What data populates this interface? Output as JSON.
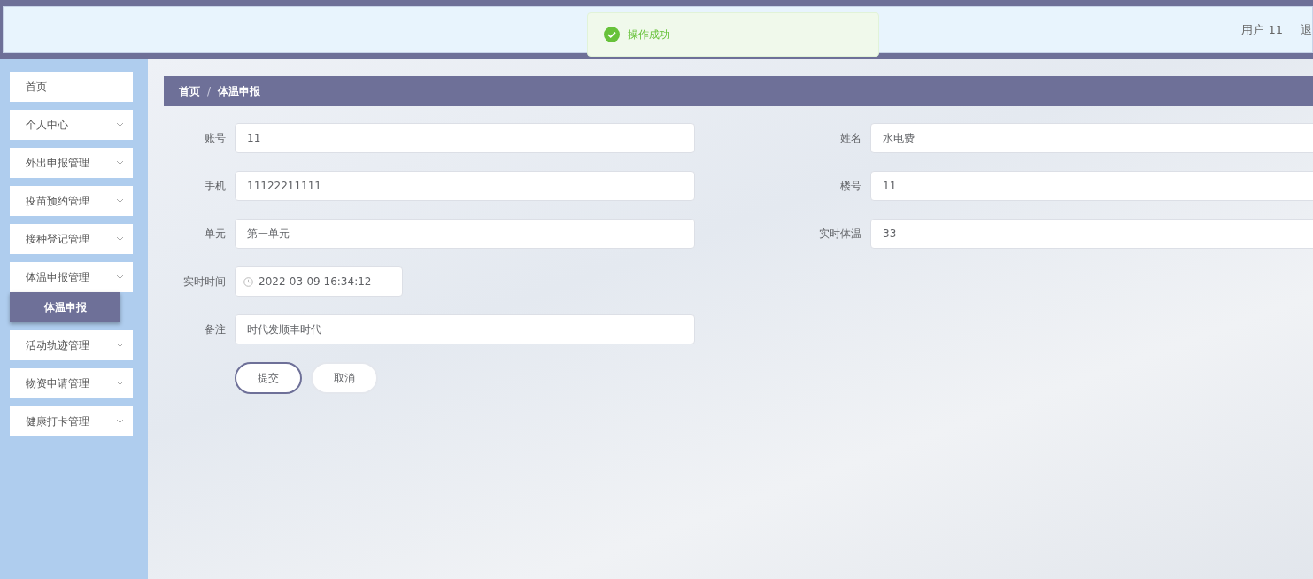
{
  "header": {
    "user_label": "用户 11",
    "logout": "退"
  },
  "toast": {
    "kind": "success",
    "message": "操作成功"
  },
  "sidebar": {
    "items": [
      {
        "label": "首页",
        "kind": "link"
      },
      {
        "label": "个人中心",
        "kind": "submenu"
      },
      {
        "label": "外出申报管理",
        "kind": "submenu"
      },
      {
        "label": "疫苗预约管理",
        "kind": "submenu"
      },
      {
        "label": "接种登记管理",
        "kind": "submenu"
      },
      {
        "label": "体温申报管理",
        "kind": "submenu",
        "children": [
          {
            "label": "体温申报",
            "selected": true
          }
        ]
      },
      {
        "label": "活动轨迹管理",
        "kind": "submenu"
      },
      {
        "label": "物资申请管理",
        "kind": "submenu"
      },
      {
        "label": "健康打卡管理",
        "kind": "submenu"
      }
    ]
  },
  "breadcrumb": {
    "items": [
      "首页",
      "体温申报"
    ],
    "separator": "/"
  },
  "form": {
    "rows": [
      {
        "fields": [
          {
            "label": "账号",
            "value": "11",
            "kind": "text"
          },
          {
            "label": "姓名",
            "value": "水电费",
            "kind": "text"
          }
        ]
      },
      {
        "fields": [
          {
            "label": "手机",
            "value": "11122211111",
            "kind": "text"
          },
          {
            "label": "楼号",
            "value": "11",
            "kind": "text"
          }
        ]
      },
      {
        "fields": [
          {
            "label": "单元",
            "value": "第一单元",
            "kind": "text"
          },
          {
            "label": "实时体温",
            "value": "33",
            "kind": "text"
          }
        ]
      },
      {
        "fields": [
          {
            "label": "实时时间",
            "value": "2022-03-09 16:34:12",
            "kind": "datetime"
          }
        ]
      },
      {
        "fields": [
          {
            "label": "备注",
            "value": "时代发顺丰时代",
            "kind": "text"
          }
        ]
      }
    ],
    "buttons": [
      {
        "label": "提交",
        "kind": "primary"
      },
      {
        "label": "取消",
        "kind": "default"
      }
    ]
  }
}
